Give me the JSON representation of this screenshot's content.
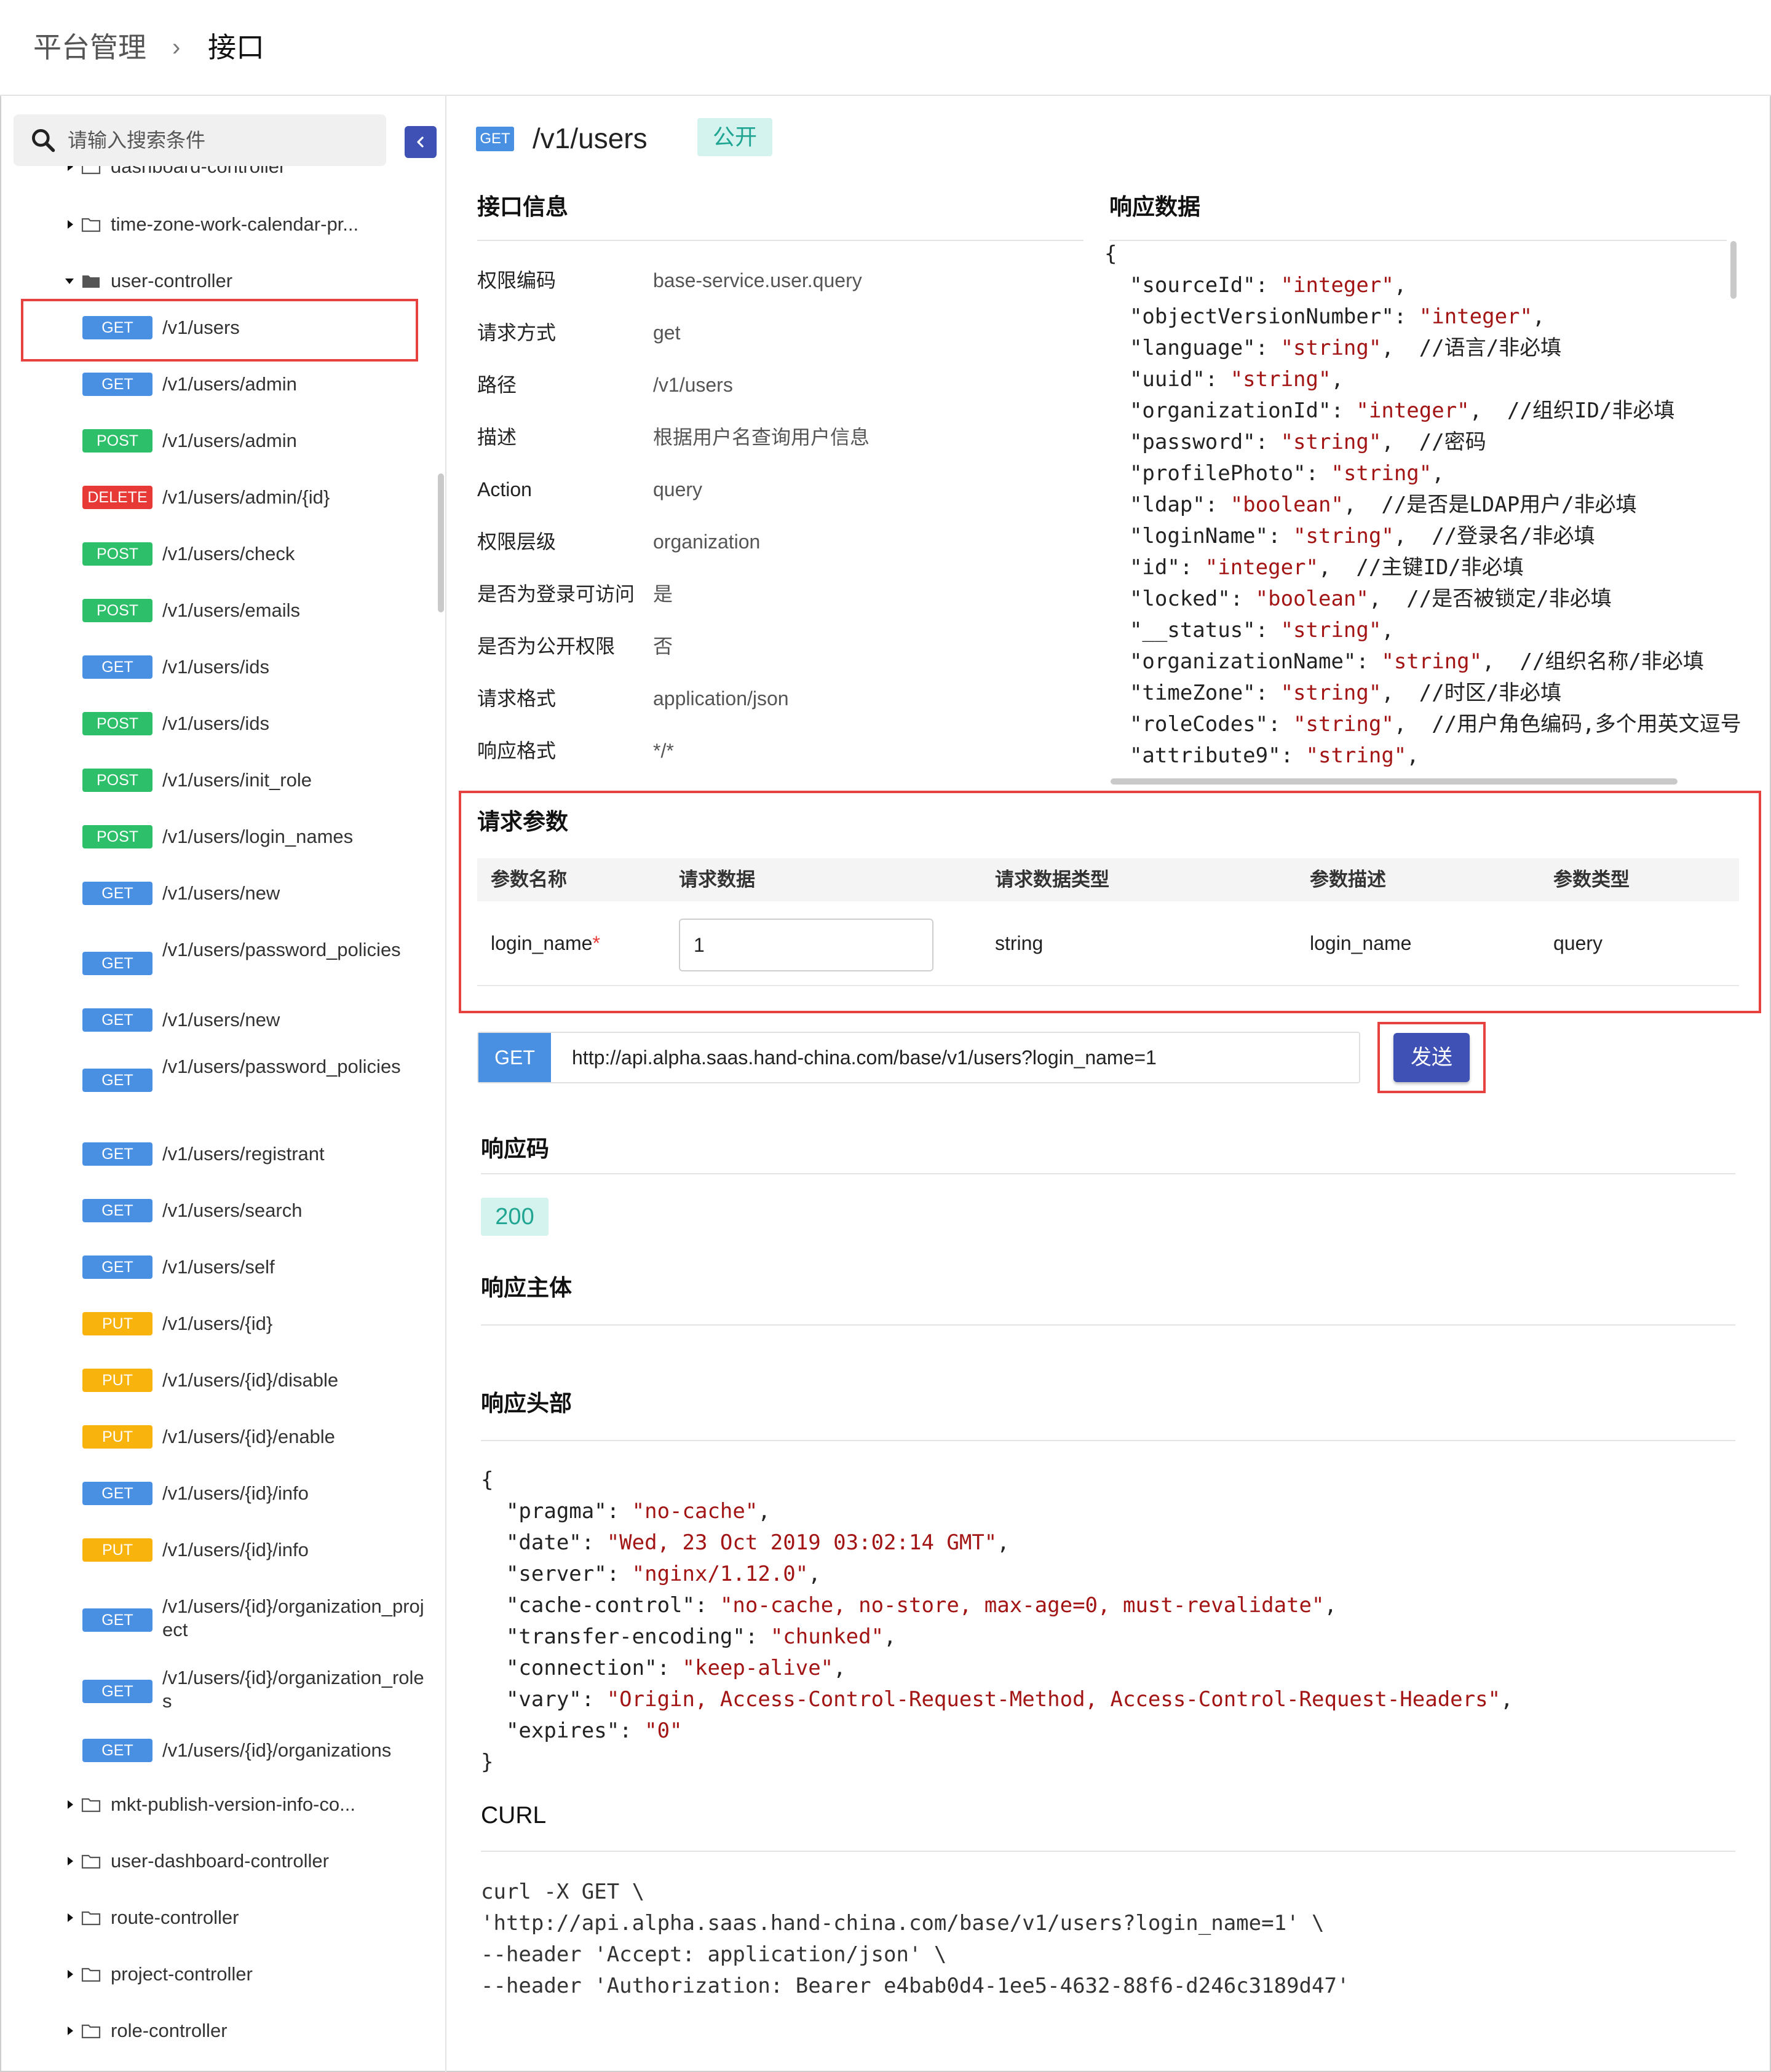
{
  "breadcrumb": {
    "parent": "平台管理",
    "separator": "›",
    "current": "接口"
  },
  "search": {
    "placeholder": "请输入搜索条件"
  },
  "sidebar": {
    "folders_top": [
      {
        "name": "dashboard-controller"
      },
      {
        "name": "time-zone-work-calendar-pr..."
      },
      {
        "name": "user-controller"
      }
    ],
    "apis": [
      {
        "method": "GET",
        "path": "/v1/users"
      },
      {
        "method": "GET",
        "path": "/v1/users/admin"
      },
      {
        "method": "POST",
        "path": "/v1/users/admin"
      },
      {
        "method": "DELETE",
        "path": "/v1/users/admin/{id}"
      },
      {
        "method": "POST",
        "path": "/v1/users/check"
      },
      {
        "method": "POST",
        "path": "/v1/users/emails"
      },
      {
        "method": "GET",
        "path": "/v1/users/ids"
      },
      {
        "method": "POST",
        "path": "/v1/users/ids"
      },
      {
        "method": "POST",
        "path": "/v1/users/init_role"
      },
      {
        "method": "POST",
        "path": "/v1/users/login_names"
      },
      {
        "method": "GET",
        "path": "/v1/users/new"
      },
      {
        "method": "GET",
        "path": "/v1/users/password_policies"
      },
      {
        "method": "GET",
        "path": "/v1/users/new"
      },
      {
        "method": "GET",
        "path": "/v1/users/password_policies"
      },
      {
        "method": "GET",
        "path": "/v1/users/registrant"
      },
      {
        "method": "GET",
        "path": "/v1/users/search"
      },
      {
        "method": "GET",
        "path": "/v1/users/self"
      },
      {
        "method": "PUT",
        "path": "/v1/users/{id}"
      },
      {
        "method": "PUT",
        "path": "/v1/users/{id}/disable"
      },
      {
        "method": "PUT",
        "path": "/v1/users/{id}/enable"
      },
      {
        "method": "GET",
        "path": "/v1/users/{id}/info"
      },
      {
        "method": "PUT",
        "path": "/v1/users/{id}/info"
      },
      {
        "method": "GET",
        "path": "/v1/users/{id}/organization_project"
      },
      {
        "method": "GET",
        "path": "/v1/users/{id}/organization_roles"
      },
      {
        "method": "GET",
        "path": "/v1/users/{id}/organizations"
      }
    ],
    "folders_bottom": [
      {
        "name": "mkt-publish-version-info-co..."
      },
      {
        "name": "user-dashboard-controller"
      },
      {
        "name": "route-controller"
      },
      {
        "name": "project-controller"
      },
      {
        "name": "role-controller"
      }
    ]
  },
  "api_header": {
    "method": "GET",
    "path": "/v1/users",
    "visibility": "公开"
  },
  "info": {
    "title": "接口信息",
    "rows": [
      {
        "key": "权限编码",
        "value": "base-service.user.query"
      },
      {
        "key": "请求方式",
        "value": "get"
      },
      {
        "key": "路径",
        "value": "/v1/users"
      },
      {
        "key": "描述",
        "value": "根据用户名查询用户信息"
      },
      {
        "key": "Action",
        "value": "query"
      },
      {
        "key": "权限层级",
        "value": "organization"
      },
      {
        "key": "是否为登录可访问",
        "value": "是"
      },
      {
        "key": "是否为公开权限",
        "value": "否"
      },
      {
        "key": "请求格式",
        "value": "application/json"
      },
      {
        "key": "响应格式",
        "value": "*/*"
      }
    ]
  },
  "response_data": {
    "title": "响应数据",
    "open": "{",
    "lines": [
      {
        "k": "\"sourceId\": ",
        "v": "\"integer\"",
        "c": ","
      },
      {
        "k": "\"objectVersionNumber\": ",
        "v": "\"integer\"",
        "c": ","
      },
      {
        "k": "\"language\": ",
        "v": "\"string\"",
        "c": ",  //语言/非必填"
      },
      {
        "k": "\"uuid\": ",
        "v": "\"string\"",
        "c": ","
      },
      {
        "k": "\"organizationId\": ",
        "v": "\"integer\"",
        "c": ",  //组织ID/非必填"
      },
      {
        "k": "\"password\": ",
        "v": "\"string\"",
        "c": ",  //密码"
      },
      {
        "k": "\"profilePhoto\": ",
        "v": "\"string\"",
        "c": ","
      },
      {
        "k": "\"ldap\": ",
        "v": "\"boolean\"",
        "c": ",  //是否是LDAP用户/非必填"
      },
      {
        "k": "\"loginName\": ",
        "v": "\"string\"",
        "c": ",  //登录名/非必填"
      },
      {
        "k": "\"id\": ",
        "v": "\"integer\"",
        "c": ",  //主键ID/非必填"
      },
      {
        "k": "\"locked\": ",
        "v": "\"boolean\"",
        "c": ",  //是否被锁定/非必填"
      },
      {
        "k": "\"__status\": ",
        "v": "\"string\"",
        "c": ","
      },
      {
        "k": "\"organizationName\": ",
        "v": "\"string\"",
        "c": ",  //组织名称/非必填"
      },
      {
        "k": "\"timeZone\": ",
        "v": "\"string\"",
        "c": ",  //时区/非必填"
      },
      {
        "k": "\"roleCodes\": ",
        "v": "\"string\"",
        "c": ",  //用户角色编码,多个用英文逗号"
      },
      {
        "k": "\"attribute9\": ",
        "v": "\"string\"",
        "c": ","
      }
    ]
  },
  "request_params": {
    "title": "请求参数",
    "headers": [
      "参数名称",
      "请求数据",
      "请求数据类型",
      "参数描述",
      "参数类型"
    ],
    "row": {
      "name": "login_name",
      "required_mark": "*",
      "value": "1",
      "data_type": "string",
      "description": "login_name",
      "param_type": "query"
    }
  },
  "request_bar": {
    "method": "GET",
    "url": "http://api.alpha.saas.hand-china.com/base/v1/users?login_name=1",
    "send_label": "发送"
  },
  "response_code": {
    "title": "响应码",
    "value": "200"
  },
  "response_body": {
    "title": "响应主体"
  },
  "response_headers": {
    "title": "响应头部",
    "open": "{",
    "close": "}",
    "lines": [
      {
        "k": "\"pragma\": ",
        "v": "\"no-cache\"",
        "c": ","
      },
      {
        "k": "\"date\": ",
        "v": "\"Wed, 23 Oct 2019 03:02:14 GMT\"",
        "c": ","
      },
      {
        "k": "\"server\": ",
        "v": "\"nginx/1.12.0\"",
        "c": ","
      },
      {
        "k": "\"cache-control\": ",
        "v": "\"no-cache, no-store, max-age=0, must-revalidate\"",
        "c": ","
      },
      {
        "k": "\"transfer-encoding\": ",
        "v": "\"chunked\"",
        "c": ","
      },
      {
        "k": "\"connection\": ",
        "v": "\"keep-alive\"",
        "c": ","
      },
      {
        "k": "\"vary\": ",
        "v": "\"Origin, Access-Control-Request-Method, Access-Control-Request-Headers\"",
        "c": ","
      },
      {
        "k": "\"expires\": ",
        "v": "\"0\"",
        "c": ""
      }
    ]
  },
  "curl": {
    "title": "CURL",
    "lines": [
      "curl -X GET \\",
      "'http://api.alpha.saas.hand-china.com/base/v1/users?login_name=1' \\",
      "--header 'Accept: application/json' \\",
      "--header 'Authorization: Bearer e4bab0d4-1ee5-4632-88f6-d246c3189d47'"
    ]
  },
  "colors": {
    "get": "#4a90e2",
    "post": "#2ebf6a",
    "put": "#f9b30d",
    "delete": "#e73a36",
    "primary": "#3f51b5",
    "highlight": "#e64340",
    "tag_bg": "#d4f3ee",
    "tag_text": "#1fa591"
  },
  "icons": {
    "search": "search-icon",
    "collapse": "chevron-left-icon",
    "folder": "folder-icon",
    "folder_open": "folder-open-icon",
    "caret": "caret-icon"
  }
}
